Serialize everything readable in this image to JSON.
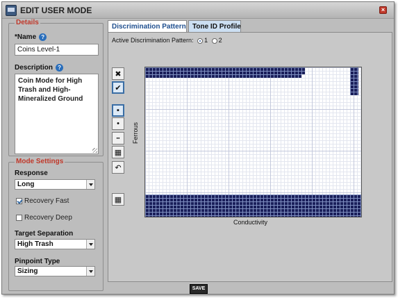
{
  "window": {
    "title": "EDIT USER MODE"
  },
  "details": {
    "legend": "Details",
    "name_label": "*Name",
    "name_value": "Coins Level-1",
    "description_label": "Description",
    "description_value": "Coin Mode for High Trash and High-Mineralized Ground"
  },
  "mode_settings": {
    "legend": "Mode Settings",
    "response_label": "Response",
    "response_value": "Long",
    "recovery_fast_label": "Recovery Fast",
    "recovery_fast_checked": true,
    "recovery_deep_label": "Recovery Deep",
    "recovery_deep_checked": false,
    "target_separation_label": "Target Separation",
    "target_separation_value": "High Trash",
    "pinpoint_type_label": "Pinpoint Type",
    "pinpoint_type_value": "Sizing"
  },
  "tabs": [
    {
      "label": "Discrimination Pattern",
      "active": true
    },
    {
      "label": "Tone ID Profile",
      "active": false
    }
  ],
  "discrimination": {
    "active_label": "Active Discrimination Pattern:",
    "options": [
      "1",
      "2"
    ],
    "selected": "1",
    "x_axis_label": "Conductivity",
    "y_axis_label": "Ferrous"
  },
  "tools": [
    {
      "icon": "reject-icon",
      "glyph": "✖"
    },
    {
      "icon": "accept-icon",
      "glyph": "✔"
    },
    {
      "icon": "single-cell-pointer-icon",
      "glyph": "▪"
    },
    {
      "icon": "small-brush-icon",
      "glyph": "•"
    },
    {
      "icon": "medium-brush-icon",
      "glyph": "▪▪"
    },
    {
      "icon": "large-brush-icon",
      "glyph": "▦"
    },
    {
      "icon": "undo-icon",
      "glyph": "↶"
    },
    {
      "icon": "grid-toggle-icon",
      "glyph": "▦"
    }
  ],
  "footer": {
    "save_label": "SAVE"
  }
}
